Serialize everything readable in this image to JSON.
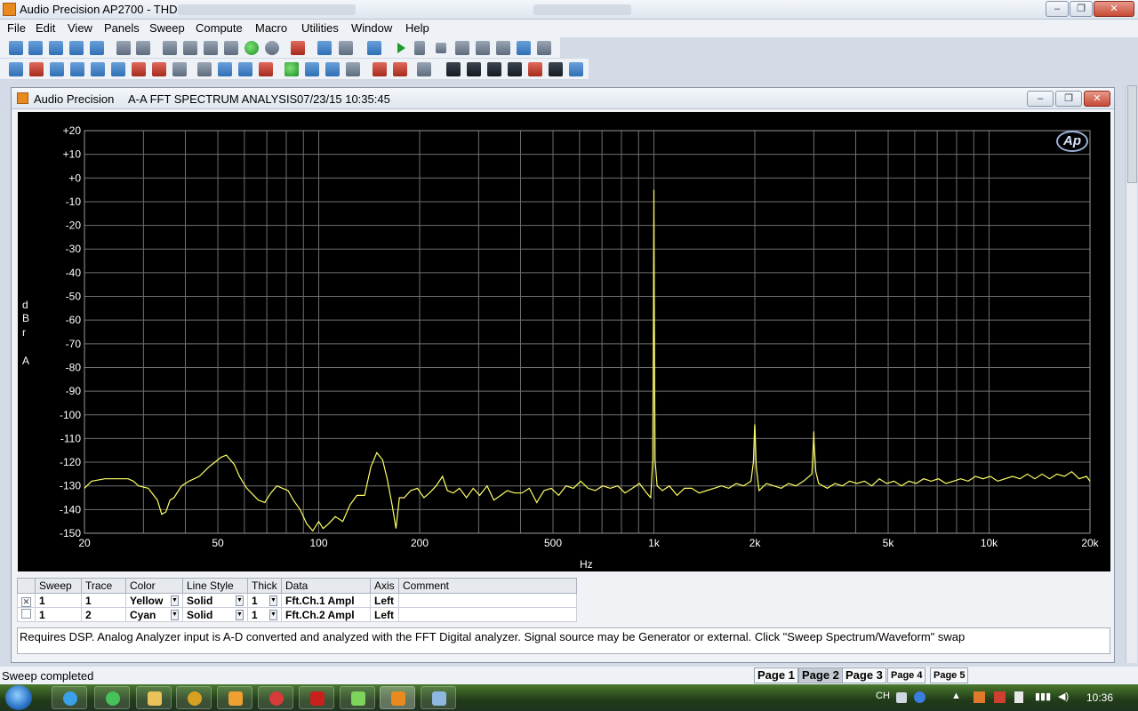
{
  "window": {
    "title": "Audio Precision AP2700 - THD",
    "controls": [
      "–",
      "❐",
      "✕"
    ]
  },
  "menu": [
    "File",
    "Edit",
    "View",
    "Panels",
    "Sweep",
    "Compute",
    "Macro",
    "Utilities",
    "Window",
    "Help"
  ],
  "graph_window": {
    "app": "Audio Precision",
    "title": "A-A FFT SPECTRUM ANALYSIS",
    "timestamp": "07/23/15 10:35:45",
    "logo": "Ap"
  },
  "chart_data": {
    "type": "line",
    "ylabel": "dBr A",
    "ylabel_letters": [
      "d",
      "B",
      "r",
      "A"
    ],
    "xlabel": "Hz",
    "x_scale": "log",
    "xlim": [
      20,
      20000
    ],
    "ylim": [
      -150,
      20
    ],
    "grid": true,
    "yticks": [
      20,
      10,
      0,
      -10,
      -20,
      -30,
      -40,
      -50,
      -60,
      -70,
      -80,
      -90,
      -100,
      -110,
      -120,
      -130,
      -140,
      -150
    ],
    "ytick_labels": [
      "+20",
      "+10",
      "+0",
      "-10",
      "-20",
      "-30",
      "-40",
      "-50",
      "-60",
      "-70",
      "-80",
      "-90",
      "-100",
      "-110",
      "-120",
      "-130",
      "-140",
      "-150"
    ],
    "xticks": [
      20,
      50,
      100,
      200,
      500,
      1000,
      2000,
      5000,
      10000,
      20000
    ],
    "xtick_labels": [
      "20",
      "50",
      "100",
      "200",
      "500",
      "1k",
      "2k",
      "5k",
      "10k",
      "20k"
    ],
    "series": [
      {
        "color": "#ffff66",
        "points": [
          [
            20,
            -131
          ],
          [
            21,
            -128
          ],
          [
            23,
            -127
          ],
          [
            25,
            -127
          ],
          [
            27,
            -127
          ],
          [
            28,
            -128
          ],
          [
            29,
            -130
          ],
          [
            31,
            -131
          ],
          [
            33,
            -136
          ],
          [
            34,
            -142
          ],
          [
            35,
            -141
          ],
          [
            36,
            -136
          ],
          [
            37,
            -135
          ],
          [
            39,
            -130
          ],
          [
            41,
            -128
          ],
          [
            44,
            -126
          ],
          [
            47,
            -122
          ],
          [
            49,
            -120
          ],
          [
            51,
            -118
          ],
          [
            53,
            -117
          ],
          [
            56,
            -121
          ],
          [
            58,
            -126
          ],
          [
            61,
            -131
          ],
          [
            64,
            -134
          ],
          [
            66,
            -136
          ],
          [
            69,
            -137
          ],
          [
            72,
            -133
          ],
          [
            75,
            -130
          ],
          [
            78,
            -131
          ],
          [
            81,
            -132
          ],
          [
            84,
            -136
          ],
          [
            88,
            -140
          ],
          [
            92,
            -146
          ],
          [
            96,
            -149
          ],
          [
            100,
            -145
          ],
          [
            103,
            -148
          ],
          [
            107,
            -146
          ],
          [
            112,
            -143
          ],
          [
            118,
            -145
          ],
          [
            124,
            -138
          ],
          [
            130,
            -134
          ],
          [
            137,
            -134
          ],
          [
            143,
            -122
          ],
          [
            149,
            -116
          ],
          [
            155,
            -119
          ],
          [
            160,
            -127
          ],
          [
            166,
            -139
          ],
          [
            170,
            -148
          ],
          [
            174,
            -135
          ],
          [
            180,
            -135
          ],
          [
            188,
            -132
          ],
          [
            197,
            -131
          ],
          [
            206,
            -135
          ],
          [
            214,
            -133
          ],
          [
            224,
            -130
          ],
          [
            234,
            -126
          ],
          [
            242,
            -132
          ],
          [
            252,
            -133
          ],
          [
            263,
            -131
          ],
          [
            276,
            -135
          ],
          [
            289,
            -131
          ],
          [
            302,
            -134
          ],
          [
            318,
            -130
          ],
          [
            333,
            -136
          ],
          [
            349,
            -134
          ],
          [
            365,
            -132
          ],
          [
            384,
            -133
          ],
          [
            404,
            -133
          ],
          [
            425,
            -131
          ],
          [
            447,
            -137
          ],
          [
            470,
            -132
          ],
          [
            494,
            -131
          ],
          [
            520,
            -134
          ],
          [
            547,
            -130
          ],
          [
            575,
            -131
          ],
          [
            605,
            -128
          ],
          [
            636,
            -131
          ],
          [
            668,
            -132
          ],
          [
            704,
            -130
          ],
          [
            741,
            -131
          ],
          [
            780,
            -130
          ],
          [
            820,
            -133
          ],
          [
            862,
            -131
          ],
          [
            906,
            -129
          ],
          [
            951,
            -133
          ],
          [
            978,
            -135
          ],
          [
            992,
            -119
          ],
          [
            997,
            -60
          ],
          [
            1000,
            -5
          ],
          [
            1003,
            -60
          ],
          [
            1008,
            -119
          ],
          [
            1022,
            -130
          ],
          [
            1060,
            -132
          ],
          [
            1112,
            -130
          ],
          [
            1172,
            -134
          ],
          [
            1233,
            -131
          ],
          [
            1297,
            -131
          ],
          [
            1365,
            -133
          ],
          [
            1436,
            -132
          ],
          [
            1512,
            -131
          ],
          [
            1590,
            -130
          ],
          [
            1672,
            -131
          ],
          [
            1760,
            -129
          ],
          [
            1851,
            -130
          ],
          [
            1948,
            -128
          ],
          [
            1980,
            -120
          ],
          [
            1997,
            -105
          ],
          [
            2000,
            -104
          ],
          [
            2004,
            -107
          ],
          [
            2020,
            -122
          ],
          [
            2060,
            -132
          ],
          [
            2165,
            -129
          ],
          [
            2279,
            -130
          ],
          [
            2398,
            -131
          ],
          [
            2522,
            -129
          ],
          [
            2654,
            -130
          ],
          [
            2793,
            -128
          ],
          [
            2960,
            -125
          ],
          [
            2995,
            -110
          ],
          [
            3000,
            -107
          ],
          [
            3006,
            -112
          ],
          [
            3040,
            -124
          ],
          [
            3100,
            -129
          ],
          [
            3291,
            -131
          ],
          [
            3465,
            -129
          ],
          [
            3645,
            -130
          ],
          [
            3835,
            -128
          ],
          [
            4036,
            -129
          ],
          [
            4247,
            -128
          ],
          [
            4468,
            -130
          ],
          [
            4702,
            -127
          ],
          [
            4947,
            -129
          ],
          [
            5206,
            -128
          ],
          [
            5477,
            -130
          ],
          [
            5763,
            -128
          ],
          [
            6063,
            -129
          ],
          [
            6380,
            -127
          ],
          [
            6713,
            -128
          ],
          [
            7063,
            -127
          ],
          [
            7432,
            -129
          ],
          [
            7820,
            -128
          ],
          [
            8228,
            -127
          ],
          [
            8657,
            -128
          ],
          [
            9109,
            -126
          ],
          [
            9584,
            -127
          ],
          [
            10084,
            -126
          ],
          [
            10610,
            -128
          ],
          [
            11164,
            -127
          ],
          [
            11747,
            -126
          ],
          [
            12360,
            -127
          ],
          [
            13005,
            -125
          ],
          [
            13683,
            -127
          ],
          [
            14397,
            -125
          ],
          [
            15148,
            -127
          ],
          [
            15938,
            -125
          ],
          [
            16770,
            -126
          ],
          [
            17645,
            -124
          ],
          [
            18566,
            -127
          ],
          [
            19535,
            -126
          ],
          [
            20000,
            -128
          ]
        ]
      }
    ]
  },
  "traces_table": {
    "headers": [
      "Sweep",
      "Trace",
      "Color",
      "Line Style",
      "Thick",
      "Data",
      "Axis",
      "Comment"
    ],
    "rows": [
      {
        "checked": "✕",
        "sweep": "1",
        "trace": "1",
        "color": "Yellow",
        "style": "Solid",
        "thick": "1",
        "data": "Fft.Ch.1 Ampl",
        "axis": "Left",
        "comment": ""
      },
      {
        "checked": "",
        "sweep": "1",
        "trace": "2",
        "color": "Cyan",
        "style": "Solid",
        "thick": "1",
        "data": "Fft.Ch.2 Ampl",
        "axis": "Left",
        "comment": ""
      }
    ]
  },
  "comment_text": "Requires DSP.  Analog Analyzer input is A-D converted and analyzed with the FFT Digital analyzer.  Signal source may be Generator or external.  Click \"Sweep Spectrum/Waveform\" swap",
  "status": "Sweep completed",
  "pages": [
    "Page 1",
    "Page 2",
    "Page 3",
    "Page 4",
    "Page 5"
  ],
  "active_page": "Page 2",
  "tray": {
    "lang": "CH",
    "time": "10:36"
  }
}
